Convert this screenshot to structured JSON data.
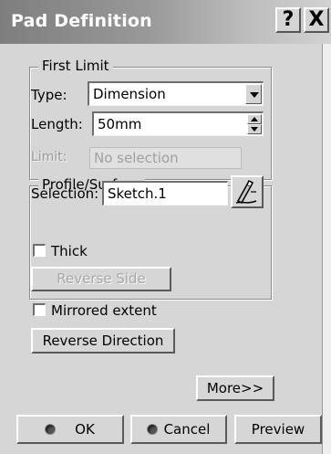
{
  "window": {
    "title": "Pad Definition",
    "help_glyph": "?",
    "close_glyph": "X"
  },
  "first_limit": {
    "title": "First Limit",
    "type_label": "Type:",
    "type_value": "Dimension",
    "length_label": "Length:",
    "length_value": "50mm",
    "limit_label": "Limit:",
    "limit_value": "No selection"
  },
  "profile": {
    "title": "Profile/Surface",
    "selection_label": "Selection:",
    "selection_value": "Sketch.1",
    "sketch_icon": "sketch-pencil-icon",
    "thick_label": "Thick",
    "reverse_side_label": "Reverse Side"
  },
  "options": {
    "mirrored_label": "Mirrored extent",
    "reverse_direction_label": "Reverse Direction",
    "more_label": "More>>"
  },
  "footer": {
    "ok_label": "OK",
    "cancel_label": "Cancel",
    "preview_label": "Preview"
  },
  "colors": {
    "dialog_bg": "#d6d6d6",
    "title_text": "#ffffff"
  }
}
